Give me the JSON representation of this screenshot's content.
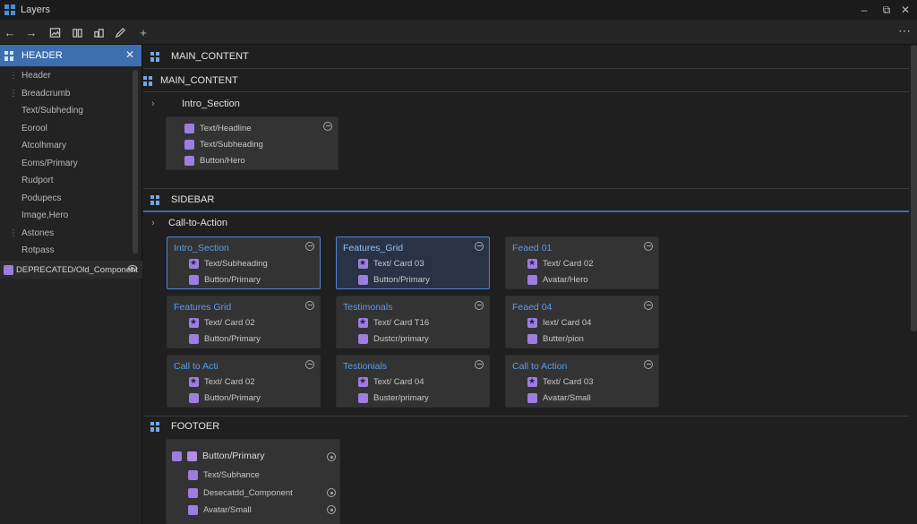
{
  "window": {
    "title": "Layers"
  },
  "sidebar": {
    "header": "HEADER",
    "items": [
      "Header",
      "Breadcrumb",
      "Text/Subheding",
      "Eorool",
      "Atcolhmary",
      "Eoms/Primary",
      "Rudport",
      "Podupecs",
      "Image,Hero",
      "Astones",
      "Rotpass"
    ],
    "deprecated": "DEPRECATED/Old_Component"
  },
  "main": {
    "sections": [
      {
        "label": "MAIN_CONTENT"
      },
      {
        "label": "MAIN_CONTENT"
      },
      {
        "label": "SIDEBAR"
      },
      {
        "label": "FOOTOER"
      }
    ],
    "intro_label": "Intro_Section",
    "intro_card": [
      "Text/Headline",
      "Text/Subheading",
      "Button/Hero"
    ],
    "cta_label": "Call-to-Action",
    "grid": [
      {
        "title": "Intro_Section",
        "rows": [
          "Text/Subheading",
          "Button/Primary"
        ]
      },
      {
        "title": "Features_Grid",
        "rows": [
          "Text/ Card 03",
          "Button/Primary"
        ]
      },
      {
        "title": "Feaed 01",
        "rows": [
          "Text/ Card 02",
          "Avatar/Hero"
        ]
      },
      {
        "title": "Features Grid",
        "rows": [
          "Text/ Card 02",
          "Button/Primary"
        ]
      },
      {
        "title": "Testimonals",
        "rows": [
          "Text/ Card T16",
          "Dustcr/primary"
        ]
      },
      {
        "title": "Feaed 04",
        "rows": [
          "Iext/ Card 04",
          "Butter/pion"
        ]
      },
      {
        "title": "Call to Acti",
        "rows": [
          "Text/ Card 02",
          "Button/Primary"
        ]
      },
      {
        "title": "Testionials",
        "rows": [
          "Text/ Card 04",
          "Buster/primary"
        ]
      },
      {
        "title": "Call to Action",
        "rows": [
          "Text/ Card 03",
          "Avatar/Small"
        ]
      }
    ],
    "footer_card": [
      "Button/Primary",
      "Text/Subhance",
      "Desecatdd_Component",
      "Avatar/Small"
    ]
  },
  "colors": {
    "accent": "#3d6fb0",
    "component": "#9b7ee0",
    "link": "#5b9ee6"
  }
}
